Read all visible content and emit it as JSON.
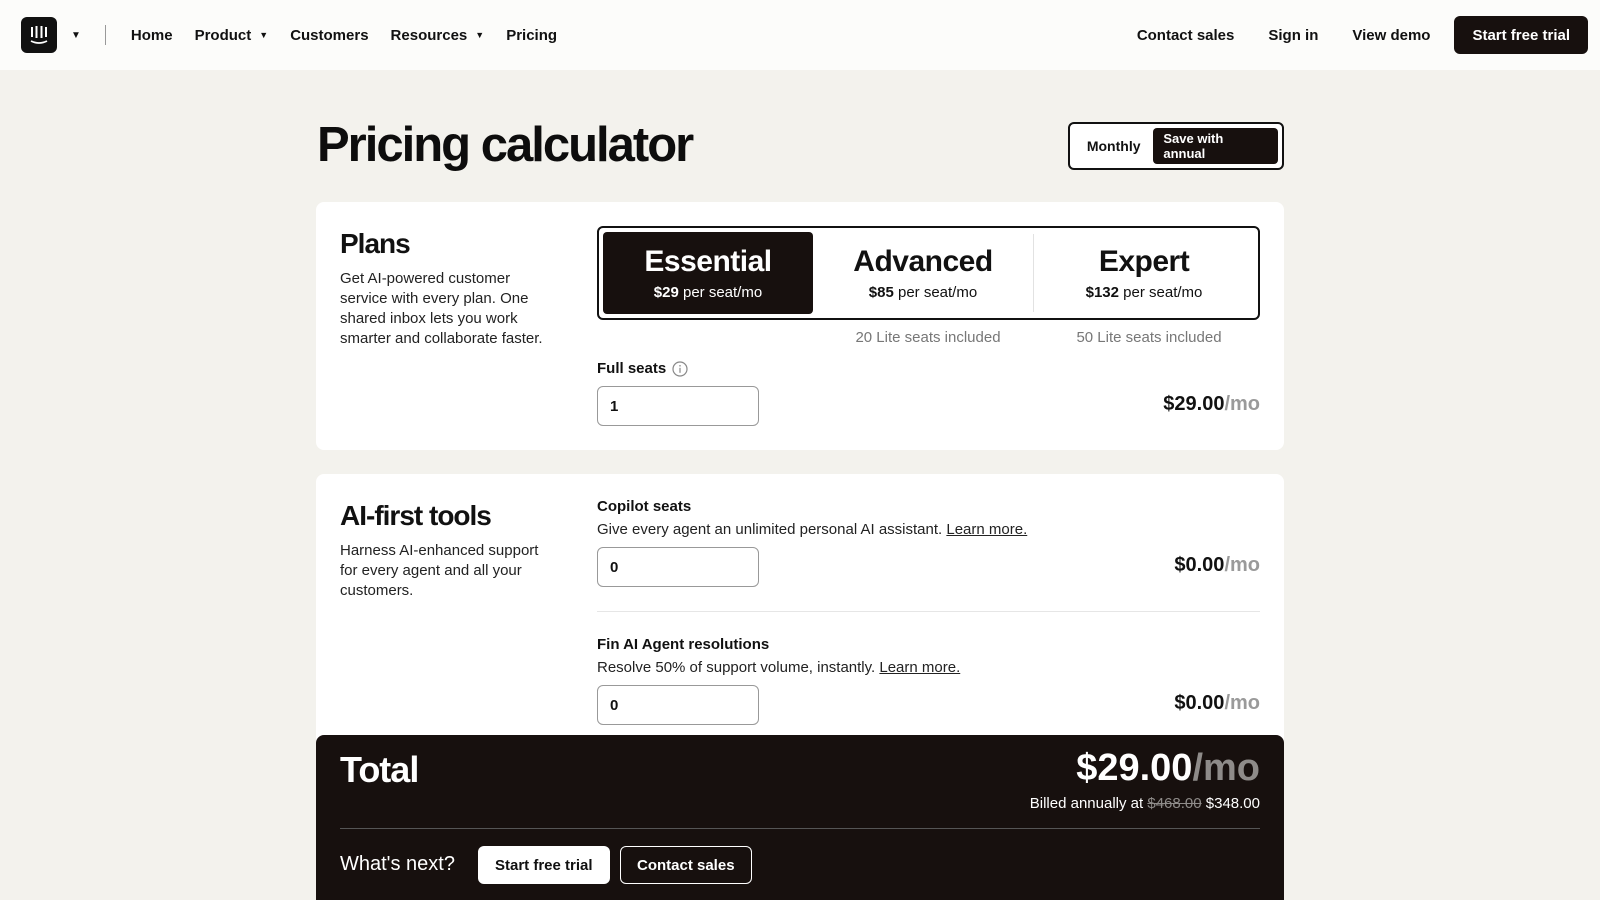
{
  "nav": {
    "links": [
      "Home",
      "Product",
      "Customers",
      "Resources",
      "Pricing"
    ],
    "right": {
      "contact_sales": "Contact sales",
      "sign_in": "Sign in",
      "view_demo": "View demo",
      "start_trial": "Start free trial"
    }
  },
  "header": {
    "title": "Pricing calculator",
    "toggle": {
      "monthly": "Monthly",
      "annual": "Save with annual",
      "selected": "annual"
    }
  },
  "plans": {
    "title": "Plans",
    "description": "Get AI-powered customer service with every plan. One shared inbox lets you work smarter and collaborate faster.",
    "options": [
      {
        "name": "Essential",
        "price": "$29",
        "unit": "per seat/mo",
        "note": "",
        "selected": true
      },
      {
        "name": "Advanced",
        "price": "$85",
        "unit": "per seat/mo",
        "note": "20 Lite seats included",
        "selected": false
      },
      {
        "name": "Expert",
        "price": "$132",
        "unit": "per seat/mo",
        "note": "50 Lite seats included",
        "selected": false
      }
    ],
    "full_seats": {
      "label": "Full seats",
      "value": "1",
      "price": "$29.00",
      "per": "/mo"
    }
  },
  "ai_tools": {
    "title": "AI-first tools",
    "description": "Harness AI-enhanced support for every agent and all your customers.",
    "copilot": {
      "label": "Copilot seats",
      "description": "Give every agent an unlimited personal AI assistant.",
      "link": "Learn more.",
      "value": "0",
      "price": "$0.00",
      "per": "/mo"
    },
    "fin": {
      "label": "Fin AI Agent resolutions",
      "description": "Resolve 50% of support volume, instantly.",
      "link": "Learn more.",
      "value": "0",
      "price": "$0.00",
      "per": "/mo"
    }
  },
  "total": {
    "label": "Total",
    "amount": "$29.00",
    "per": "/mo",
    "billed_prefix": "Billed annually at",
    "original": "$468.00",
    "discounted": "$348.00",
    "whats_next": "What's next?",
    "start_trial": "Start free trial",
    "contact_sales": "Contact sales"
  },
  "colors": {
    "dark": "#17100e",
    "background": "#f3f2ed",
    "muted": "#9a9a9a"
  },
  "icons": [
    "intercom-logo-icon",
    "chevron-down-icon",
    "info-icon"
  ]
}
